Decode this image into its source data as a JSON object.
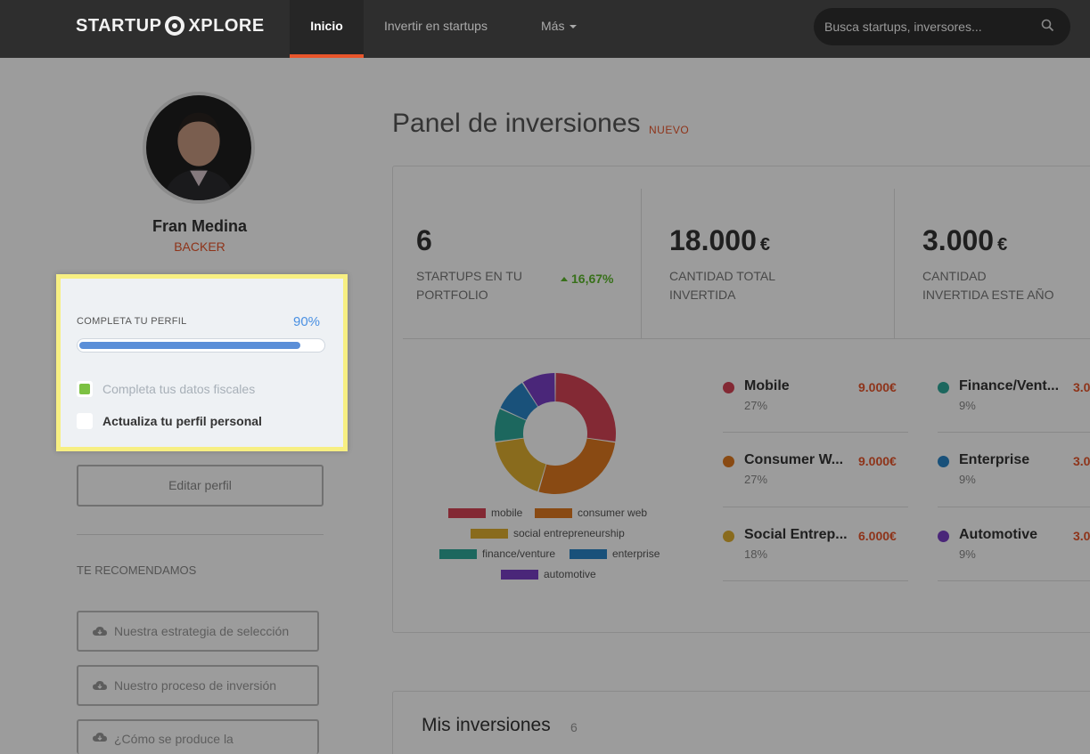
{
  "nav": {
    "logo_left": "STARTUP",
    "logo_right": "XPLORE",
    "tabs": [
      {
        "label": "Inicio"
      },
      {
        "label": "Invertir en startups"
      },
      {
        "label": "Más"
      }
    ],
    "search_placeholder": "Busca startups, inversores..."
  },
  "user": {
    "name": "Fran Medina",
    "role": "BACKER"
  },
  "profile": {
    "title": "COMPLETA TU PERFIL",
    "percent_label": "90%",
    "progress": 0.9,
    "tasks": [
      {
        "label": "Completa tus datos fiscales",
        "done": true
      },
      {
        "label": "Actualiza tu perfil personal",
        "done": false
      }
    ]
  },
  "sidebar": {
    "edit_label": "Editar perfil",
    "recommend_title": "TE RECOMENDAMOS",
    "recommend": [
      {
        "label": "Nuestra estrategia de selección"
      },
      {
        "label": "Nuestro proceso de inversión"
      },
      {
        "label": "¿Cómo se produce la"
      }
    ]
  },
  "panel": {
    "title": "Panel de inversiones",
    "badge": "NUEVO",
    "stats": [
      {
        "value": "6",
        "currency": "",
        "label_1": "STARTUPS EN TU",
        "label_2": "PORTFOLIO",
        "change": "16,67%"
      },
      {
        "value": "18.000",
        "currency": "€",
        "label_1": "CANTIDAD TOTAL",
        "label_2": "INVERTIDA"
      },
      {
        "value": "3.000",
        "currency": "€",
        "label_1": "CANTIDAD",
        "label_2": "INVERTIDA ESTE AÑO"
      }
    ],
    "sectors": [
      {
        "name": "Mobile",
        "pct": "27%",
        "amount": "9.000€",
        "color": "#d64456"
      },
      {
        "name": "Consumer W...",
        "pct": "27%",
        "amount": "9.000€",
        "color": "#e07a1f"
      },
      {
        "name": "Social Entrep...",
        "pct": "18%",
        "amount": "6.000€",
        "color": "#e0b030"
      },
      {
        "name": "Finance/Vent...",
        "pct": "9%",
        "amount": "3.0",
        "color": "#2ea89a"
      },
      {
        "name": "Enterprise",
        "pct": "9%",
        "amount": "3.0",
        "color": "#2a85c8"
      },
      {
        "name": "Automotive",
        "pct": "9%",
        "amount": "3.0",
        "color": "#7a3fc6"
      }
    ]
  },
  "chart_data": {
    "type": "pie",
    "categories": [
      "mobile",
      "consumer web",
      "social entrepreneurship",
      "finance/venture",
      "enterprise",
      "automotive"
    ],
    "values": [
      27,
      27,
      18,
      9,
      9,
      9
    ],
    "colors": [
      "#d64456",
      "#e07a1f",
      "#e0b030",
      "#2ea89a",
      "#2a85c8",
      "#7a3fc6"
    ],
    "donut": true,
    "legend_position": "bottom"
  },
  "investments": {
    "title": "Mis inversiones",
    "count": "6"
  }
}
